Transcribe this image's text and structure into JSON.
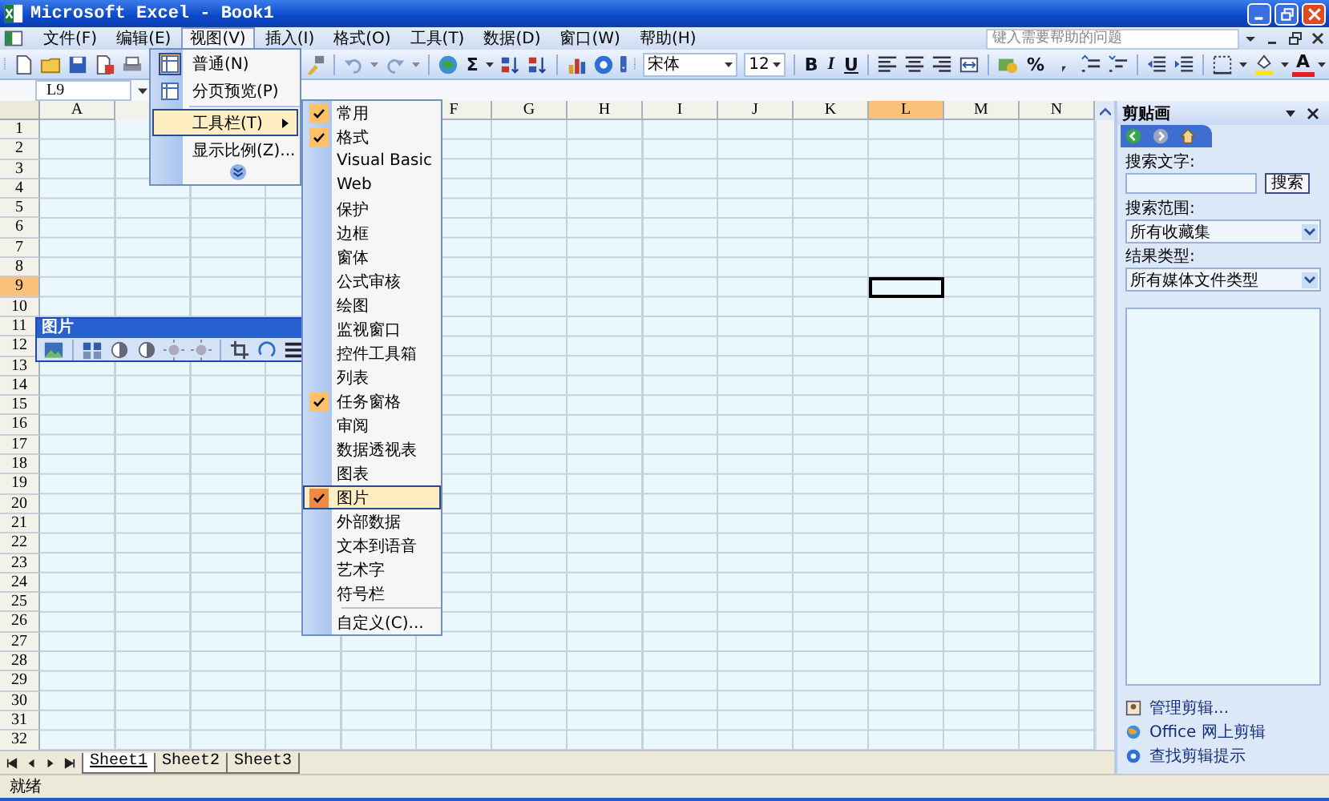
{
  "window": {
    "title": "Microsoft Excel - Book1"
  },
  "menu_bar": {
    "items": [
      {
        "label": "文件(F)",
        "selected": false
      },
      {
        "label": "编辑(E)",
        "selected": false
      },
      {
        "label": "视图(V)",
        "selected": true
      },
      {
        "label": "插入(I)",
        "selected": false
      },
      {
        "label": "格式(O)",
        "selected": false
      },
      {
        "label": "工具(T)",
        "selected": false
      },
      {
        "label": "数据(D)",
        "selected": false
      },
      {
        "label": "窗口(W)",
        "selected": false
      },
      {
        "label": "帮助(H)",
        "selected": false
      }
    ],
    "help_placeholder": "键入需要帮助的问题"
  },
  "toolbar": {
    "sum": "Σ",
    "font": "宋体",
    "font_size": "12",
    "style_buttons": [
      "B",
      "I",
      "U"
    ],
    "percent": "%",
    "font_color": "A"
  },
  "formula_bar": {
    "name_box": "L9"
  },
  "view_menu": {
    "items": [
      {
        "label": "普通(N)",
        "kind": "view",
        "checked": true,
        "selected": false
      },
      {
        "label": "分页预览(P)",
        "kind": "view",
        "checked": false,
        "selected": false
      },
      {
        "label": "工具栏(T)",
        "kind": "submenu",
        "selected": true
      },
      {
        "label": "显示比例(Z)...",
        "kind": "plain",
        "selected": false
      }
    ]
  },
  "toolbars_submenu": {
    "items": [
      {
        "label": "常用",
        "checked": true,
        "selected": false
      },
      {
        "label": "格式",
        "checked": true,
        "selected": false
      },
      {
        "label": "Visual Basic",
        "checked": false,
        "selected": false
      },
      {
        "label": "Web",
        "checked": false,
        "selected": false
      },
      {
        "label": "保护",
        "checked": false,
        "selected": false
      },
      {
        "label": "边框",
        "checked": false,
        "selected": false
      },
      {
        "label": "窗体",
        "checked": false,
        "selected": false
      },
      {
        "label": "公式审核",
        "checked": false,
        "selected": false
      },
      {
        "label": "绘图",
        "checked": false,
        "selected": false
      },
      {
        "label": "监视窗口",
        "checked": false,
        "selected": false
      },
      {
        "label": "控件工具箱",
        "checked": false,
        "selected": false
      },
      {
        "label": "列表",
        "checked": false,
        "selected": false
      },
      {
        "label": "任务窗格",
        "checked": true,
        "selected": false
      },
      {
        "label": "审阅",
        "checked": false,
        "selected": false
      },
      {
        "label": "数据透视表",
        "checked": false,
        "selected": false
      },
      {
        "label": "图表",
        "checked": false,
        "selected": false
      },
      {
        "label": "图片",
        "checked": true,
        "selected": true
      },
      {
        "label": "外部数据",
        "checked": false,
        "selected": false
      },
      {
        "label": "文本到语音",
        "checked": false,
        "selected": false
      },
      {
        "label": "艺术字",
        "checked": false,
        "selected": false
      },
      {
        "label": "符号栏",
        "checked": false,
        "selected": false
      }
    ],
    "customize": "自定义(C)..."
  },
  "picture_toolbar": {
    "title": "图片"
  },
  "sheet": {
    "columns": [
      {
        "label": "A",
        "selected": false
      },
      {
        "label": "F",
        "selected": false
      },
      {
        "label": "G",
        "selected": false
      },
      {
        "label": "H",
        "selected": false
      },
      {
        "label": "I",
        "selected": false
      },
      {
        "label": "J",
        "selected": false
      },
      {
        "label": "K",
        "selected": false
      },
      {
        "label": "L",
        "selected": true
      },
      {
        "label": "M",
        "selected": false
      },
      {
        "label": "N",
        "selected": false
      }
    ],
    "rows": [
      {
        "label": "1",
        "selected": false
      },
      {
        "label": "2",
        "selected": false
      },
      {
        "label": "3",
        "selected": false
      },
      {
        "label": "4",
        "selected": false
      },
      {
        "label": "5",
        "selected": false
      },
      {
        "label": "6",
        "selected": false
      },
      {
        "label": "7",
        "selected": false
      },
      {
        "label": "8",
        "selected": false
      },
      {
        "label": "9",
        "selected": true
      },
      {
        "label": "10",
        "selected": false
      },
      {
        "label": "11",
        "selected": false
      },
      {
        "label": "12",
        "selected": false
      },
      {
        "label": "13",
        "selected": false
      },
      {
        "label": "14",
        "selected": false
      },
      {
        "label": "15",
        "selected": false
      },
      {
        "label": "16",
        "selected": false
      },
      {
        "label": "17",
        "selected": false
      },
      {
        "label": "18",
        "selected": false
      },
      {
        "label": "19",
        "selected": false
      },
      {
        "label": "20",
        "selected": false
      },
      {
        "label": "21",
        "selected": false
      },
      {
        "label": "22",
        "selected": false
      },
      {
        "label": "23",
        "selected": false
      },
      {
        "label": "24",
        "selected": false
      },
      {
        "label": "25",
        "selected": false
      },
      {
        "label": "26",
        "selected": false
      },
      {
        "label": "27",
        "selected": false
      },
      {
        "label": "28",
        "selected": false
      },
      {
        "label": "29",
        "selected": false
      },
      {
        "label": "30",
        "selected": false
      },
      {
        "label": "31",
        "selected": false
      },
      {
        "label": "32",
        "selected": false
      }
    ]
  },
  "sheet_tabs": [
    {
      "label": "Sheet1",
      "selected": true
    },
    {
      "label": "Sheet2",
      "selected": false
    },
    {
      "label": "Sheet3",
      "selected": false
    }
  ],
  "task_pane": {
    "title": "剪贴画",
    "search_label": "搜索文字:",
    "search_button": "搜索",
    "scope_label": "搜索范围:",
    "scope_value": "所有收藏集",
    "type_label": "结果类型:",
    "type_value": "所有媒体文件类型",
    "links": [
      "管理剪辑...",
      "Office 网上剪辑",
      "查找剪辑提示"
    ]
  },
  "status_bar": {
    "text": "就绪"
  }
}
